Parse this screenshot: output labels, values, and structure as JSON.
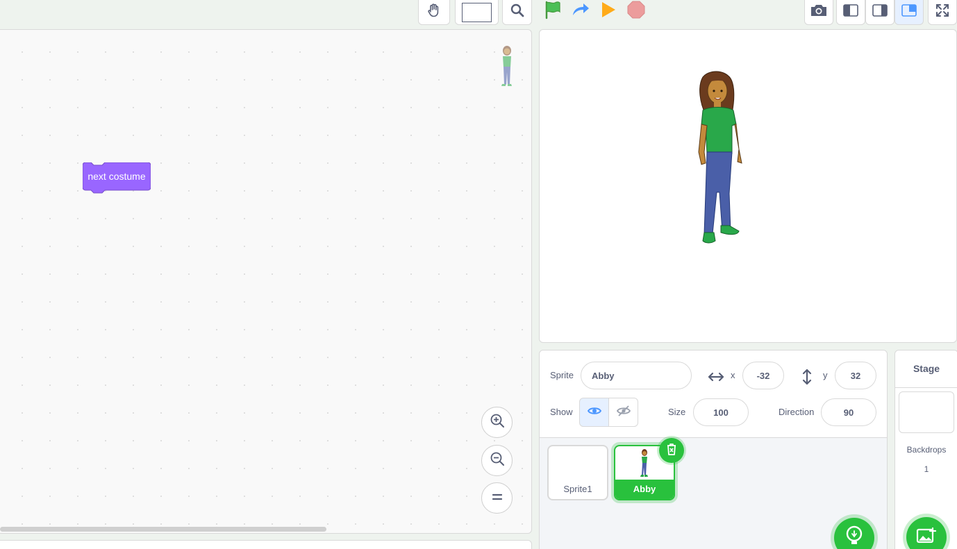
{
  "code_area": {
    "block_label": "next costume",
    "block_color": "#9966ff"
  },
  "toolbar": {
    "icons": [
      "hand-icon",
      "color-swatch",
      "search-icon",
      "green-flag-icon",
      "redo-icon",
      "play-icon",
      "stop-icon",
      "camera-icon",
      "small-stage-icon",
      "normal-stage-icon",
      "large-stage-icon",
      "fullscreen-icon"
    ]
  },
  "sprite_info": {
    "sprite_label": "Sprite",
    "sprite_name": "Abby",
    "x_label": "x",
    "x_value": "-32",
    "y_label": "y",
    "y_value": "32",
    "show_label": "Show",
    "size_label": "Size",
    "size_value": "100",
    "direction_label": "Direction",
    "direction_value": "90"
  },
  "sprites": [
    {
      "name": "Sprite1",
      "selected": false
    },
    {
      "name": "Abby",
      "selected": true
    }
  ],
  "stage_panel": {
    "title": "Stage",
    "backdrops_label": "Backdrops",
    "backdrops_count": "1"
  },
  "colors": {
    "accent_green": "#29c13d",
    "accent_blue": "#4c97ff",
    "stop_red": "#ec9c9c",
    "flag_green": "#4cbf56",
    "play_orange": "#ffab19"
  }
}
